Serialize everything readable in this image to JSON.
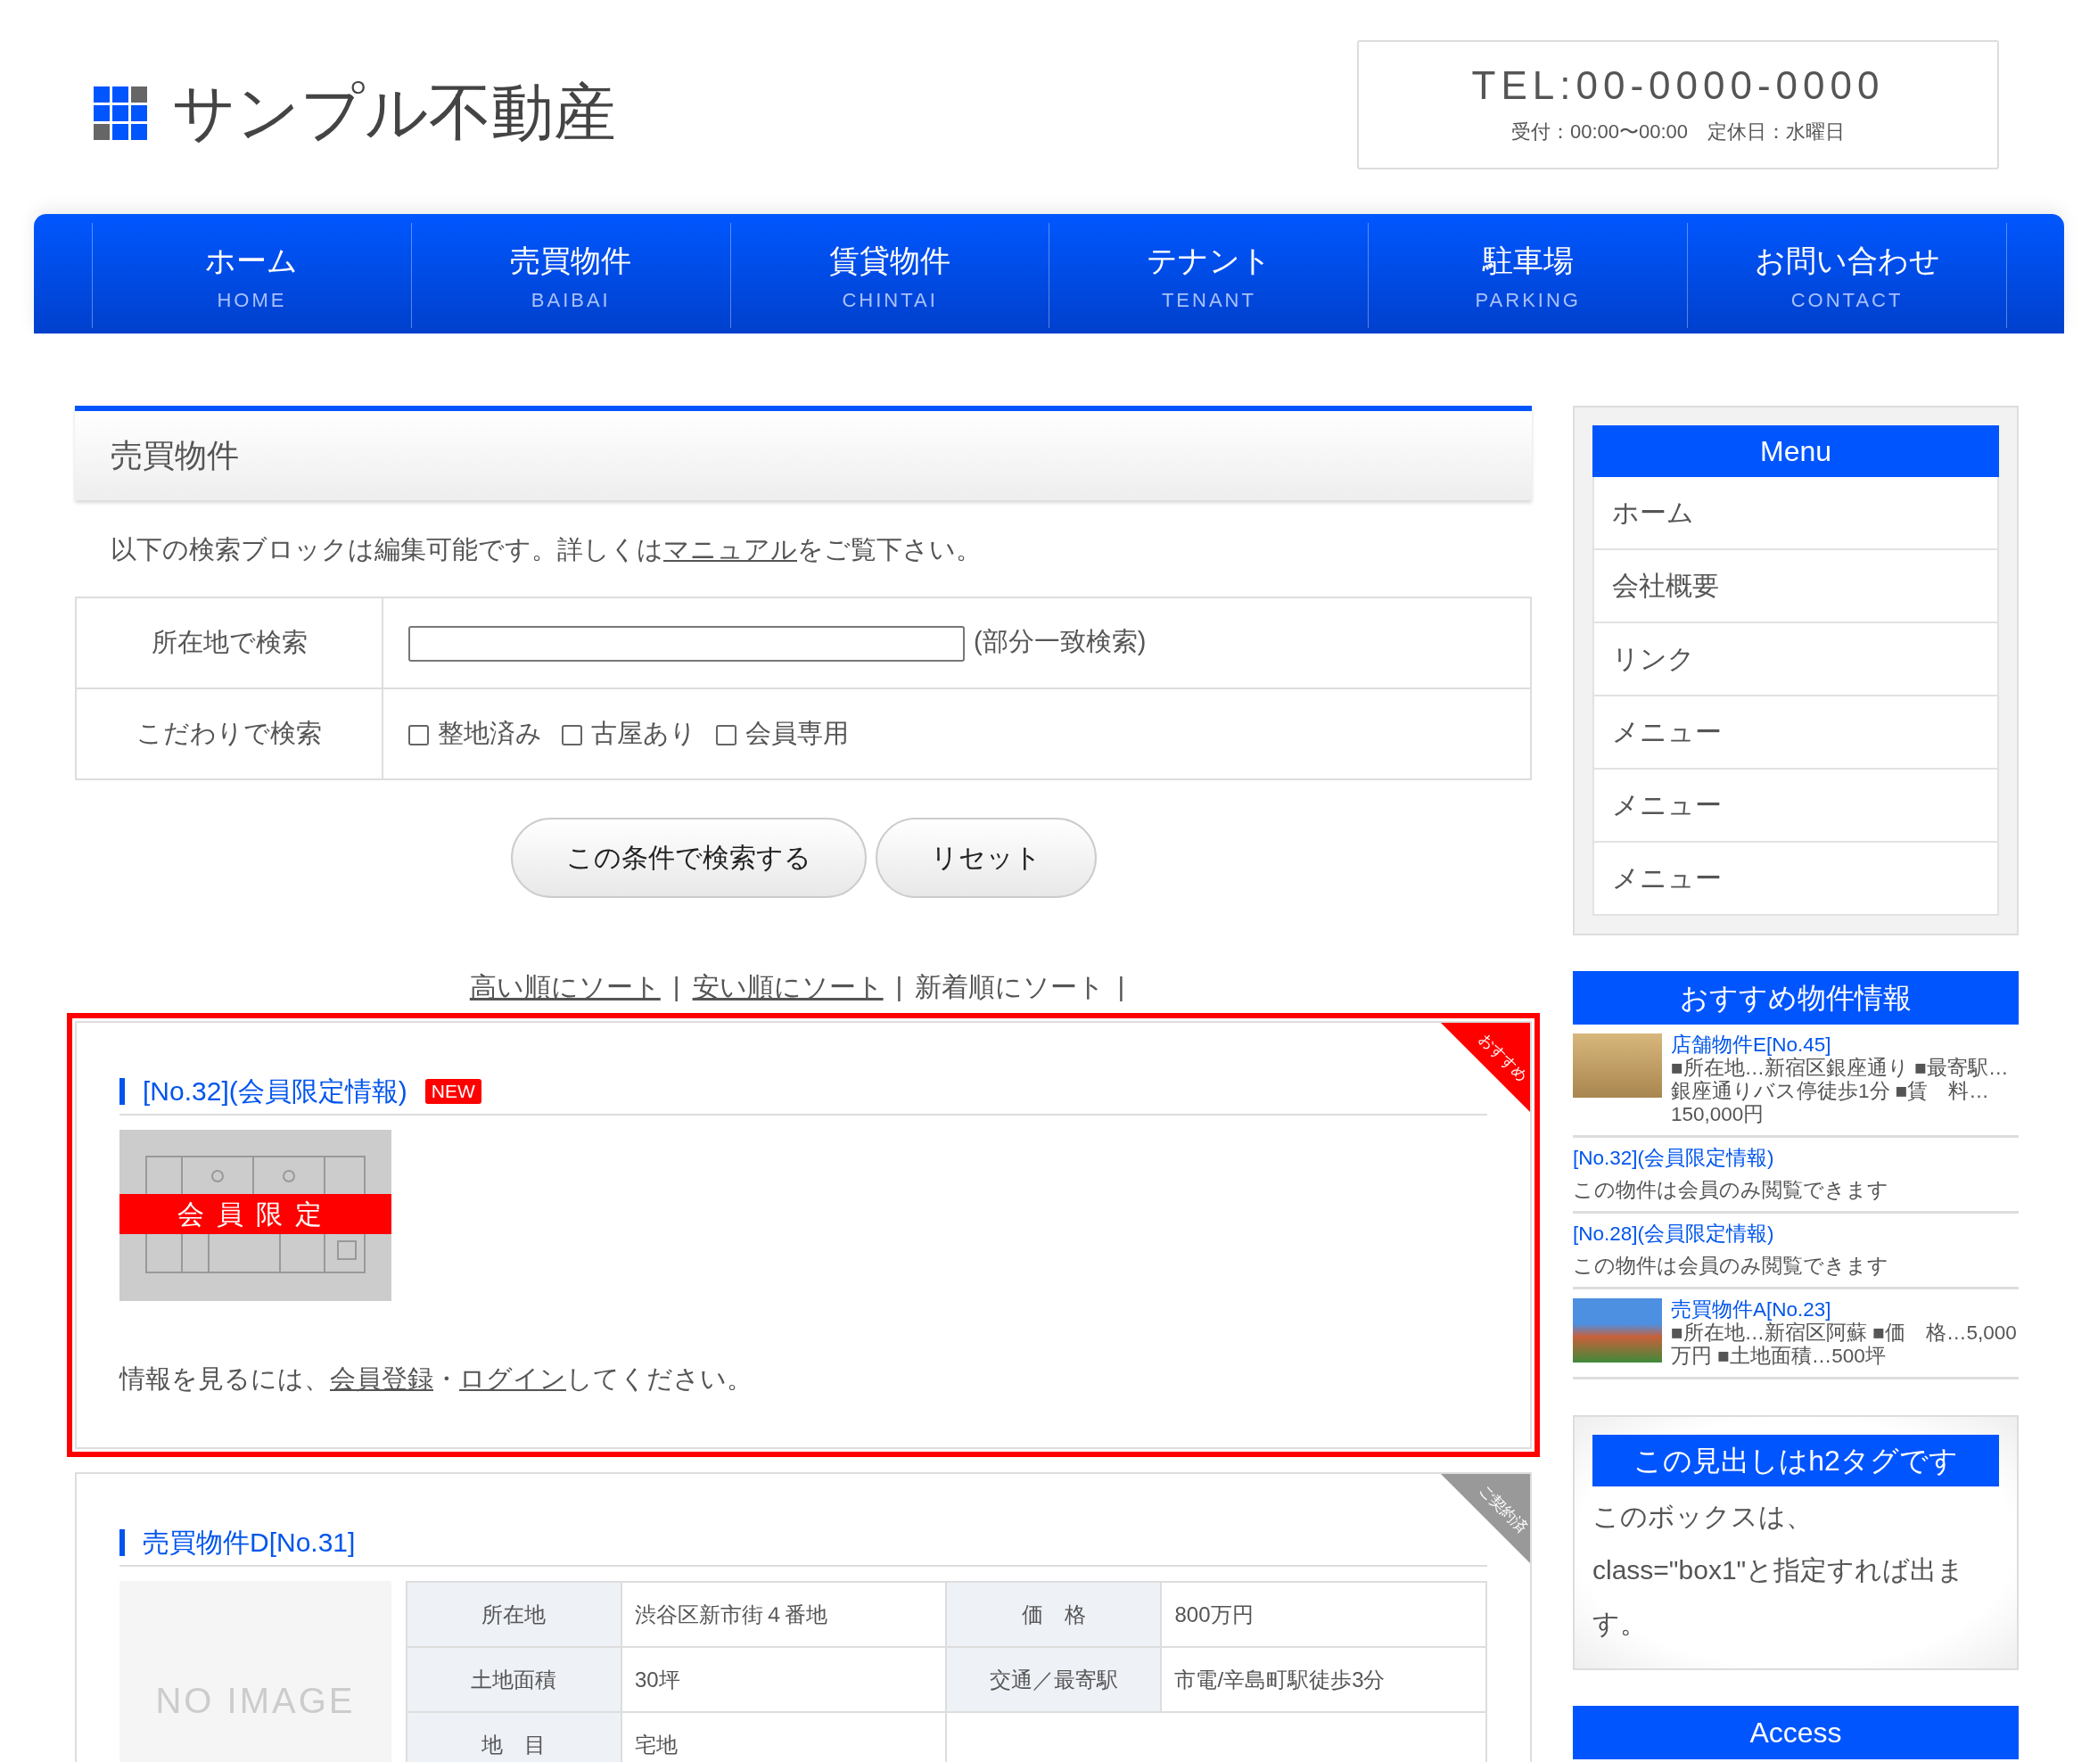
{
  "header": {
    "logo": "サンプル不動産",
    "tel": "TEL:00-0000-0000",
    "hours": "受付：00:00〜00:00　定休日：水曜日"
  },
  "nav": [
    {
      "label": "ホーム",
      "sub": "HOME"
    },
    {
      "label": "売買物件",
      "sub": "BAIBAI"
    },
    {
      "label": "賃貸物件",
      "sub": "CHINTAI"
    },
    {
      "label": "テナント",
      "sub": "TENANT"
    },
    {
      "label": "駐車場",
      "sub": "PARKING"
    },
    {
      "label": "お問い合わせ",
      "sub": "CONTACT"
    }
  ],
  "page_title": "売買物件",
  "intro": {
    "before": "以下の検索ブロックは編集可能です。詳しくは",
    "link": "マニュアル",
    "after": "をご覧下さい。"
  },
  "search": {
    "rows": [
      {
        "kind": "text",
        "label": "所在地で検索",
        "note": "(部分一致検索)"
      },
      {
        "kind": "checks",
        "label": "こだわりで検索",
        "options": [
          {
            "label": "整地済み",
            "checked": false
          },
          {
            "label": "古屋あり",
            "checked": false
          },
          {
            "label": "会員専用",
            "checked": false
          }
        ]
      }
    ],
    "buttons": [
      "この条件で検索する",
      "リセット"
    ]
  },
  "sort": [
    {
      "label": "高い順にソート",
      "link": true,
      "separator": "|"
    },
    {
      "label": "安い順にソート",
      "link": true,
      "separator": "|"
    },
    {
      "label": "新着順にソート",
      "link": false,
      "separator": "|"
    }
  ],
  "listings": [
    {
      "kind": "members",
      "highlighted": true,
      "ribbon": {
        "kind": "recommended",
        "label": "おすすめ"
      },
      "title": "[No.32](会員限定情報)",
      "badge": "NEW",
      "image_label": "会員限定",
      "message": {
        "before": "情報を見るには、",
        "link1": "会員登録",
        "mid": "・",
        "link2": "ログイン",
        "after": "してください。"
      }
    },
    {
      "kind": "details",
      "highlighted": false,
      "ribbon": {
        "kind": "contracted",
        "label": "ご契約済"
      },
      "title": "売買物件D[No.31]",
      "image_label": "NO IMAGE",
      "specs": [
        [
          {
            "label": "所在地",
            "value": "渋谷区新市街４番地"
          },
          {
            "label": "価　格",
            "value": "800万円"
          }
        ],
        [
          {
            "label": "土地面積",
            "value": "30坪"
          },
          {
            "label": "交通／最寄駅",
            "value": "市電/辛島町駅徒歩3分"
          }
        ],
        [
          {
            "label": "地　目",
            "value": "宅地"
          }
        ]
      ]
    }
  ],
  "sidebar": {
    "menu": {
      "title": "Menu",
      "items": [
        "ホーム",
        "会社概要",
        "リンク",
        "メニュー",
        "メニュー",
        "メニュー"
      ]
    },
    "featured": {
      "title": "おすすめ物件情報",
      "items": [
        {
          "kind": "photo",
          "title": "店舗物件E[No.45]",
          "text": "■所在地…新宿区銀座通り ■最寄駅…銀座通りバス停徒歩1分 ■賃　料…150,000円"
        },
        {
          "kind": "text",
          "title": "[No.32](会員限定情報)",
          "text": "この物件は会員のみ閲覧できます"
        },
        {
          "kind": "text",
          "title": "[No.28](会員限定情報)",
          "text": "この物件は会員のみ閲覧できます"
        },
        {
          "kind": "photo",
          "title": "売買物件A[No.23]",
          "text": "■所在地…新宿区阿蘇 ■価　格…5,000万円 ■土地面積…500坪"
        }
      ]
    },
    "box": {
      "title": "この見出しはh2タグです",
      "text": "このボックスは、class=\"box1\"と指定すれば出ます。"
    },
    "access": {
      "title": "Access"
    }
  }
}
